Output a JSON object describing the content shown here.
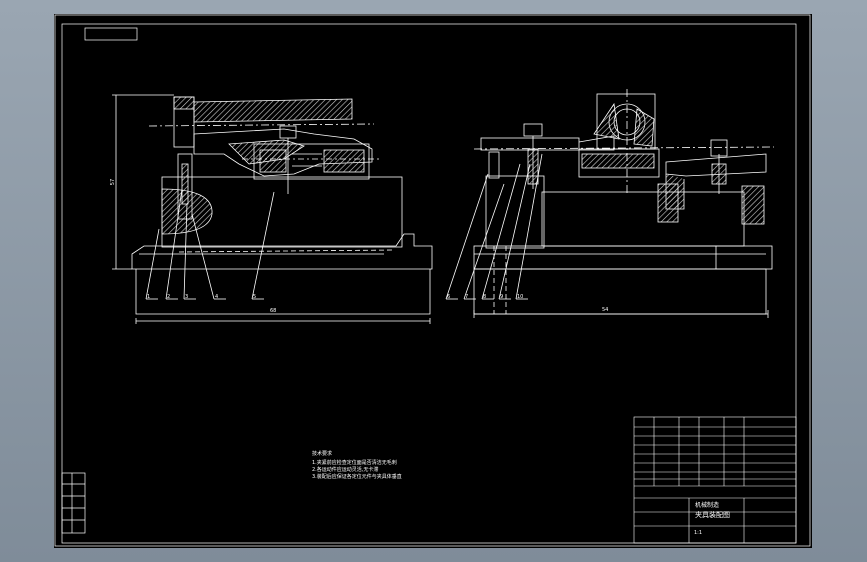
{
  "drawing": {
    "notes_title": "技术要求",
    "notes": [
      "1.夹紧前应检查定位面是否清洁无毛刺",
      "2.各运动件应运动灵活,无卡滞",
      "3.装配后应保证各定位元件与夹具体垂直"
    ],
    "title_block": {
      "product": "机械制造",
      "name": "夹具装配图",
      "scale": "1:1"
    },
    "dimension_labels": {
      "front_overall_width": "68",
      "side_overall_width": "54",
      "front_height": "57"
    },
    "balloons_front": [
      "1",
      "2",
      "3",
      "4",
      "5"
    ],
    "balloons_side": [
      "6",
      "7",
      "8",
      "9",
      "10"
    ]
  },
  "colors": {
    "background": "#000000",
    "line": "#ffffff",
    "hatch": "#c8c8c8",
    "viewport": "#8a97a4"
  }
}
